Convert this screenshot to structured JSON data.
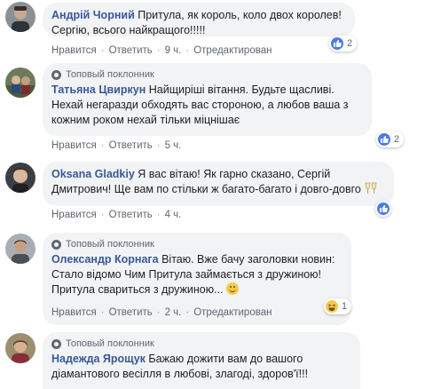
{
  "common": {
    "like_action": "Нравится",
    "reply_action": "Ответить",
    "dot": "·"
  },
  "comments": [
    {
      "author": "Андрій Чорний",
      "text": "Притула, як король, коло двох королев! Сергію, всього найкращого!!!!!",
      "time": "9 ч.",
      "edited": "Отредактирован",
      "reaction_count": "2",
      "reaction_type": "like"
    },
    {
      "fan_label": "Топовый поклонник",
      "author": "Татьяна Цвиркун",
      "text": "Найщиріші вітання. Будьте щасливі. Нехай негаразди обходять вас стороною, а любов ваша з кожним роком нехай тільки міцнішає",
      "time": "5 ч.",
      "reaction_count": "2",
      "reaction_type": "like"
    },
    {
      "author": "Oksana Gladkiy",
      "text": "Я вас вітаю! Як гарно сказано, Сергій Дмитрович! Ще вам по стільки ж багато-багато і довго-довго",
      "time": "4 ч.",
      "reaction_type": "like",
      "emoji": "clinking-glasses-emoji"
    },
    {
      "fan_label": "Топовый поклонник",
      "author": "Олександр Корнага",
      "text": "Вітаю. Вже бачу заголовки новин: Стало відомо Чим Притула займається з дружиною! Притула свариться з дружиною...",
      "time": "2 ч.",
      "edited": "Отредактирован",
      "reaction_count": "1",
      "reaction_type": "haha",
      "emoji": "smiling-face-emoji"
    },
    {
      "fan_label": "Топовый поклонник",
      "author": "Надежда Ярощук",
      "text": "Бажаю дожити вам до вашого діамантового весілля в любові, злагоді, здоров'ї!!!"
    }
  ],
  "colors": {
    "author": "#385898",
    "bubble_bg": "#f2f3f5",
    "meta_text": "#606770",
    "like_blue": "#4a7ce2",
    "haha_yellow": "#f7c84a"
  }
}
